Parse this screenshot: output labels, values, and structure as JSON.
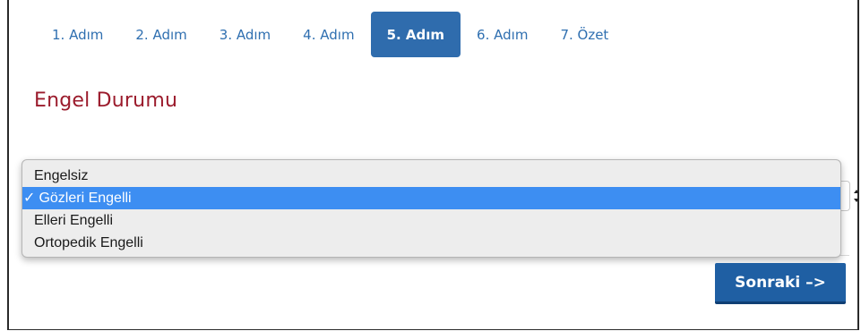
{
  "steps": [
    {
      "label": "1. Adım"
    },
    {
      "label": "2. Adım"
    },
    {
      "label": "3. Adım"
    },
    {
      "label": "4. Adım"
    },
    {
      "label": "5. Adım",
      "active": true
    },
    {
      "label": "6. Adım"
    },
    {
      "label": "7. Özet"
    }
  ],
  "section": {
    "title": "Engel Durumu"
  },
  "disability_select": {
    "selected_value": "Gözleri Engelli",
    "check_mark": "✓",
    "options": [
      {
        "label": "Engelsiz"
      },
      {
        "label": "Gözleri Engelli",
        "selected": true
      },
      {
        "label": "Elleri Engelli"
      },
      {
        "label": "Ortopedik Engelli"
      }
    ]
  },
  "next_button": {
    "label": "Sonraki –>"
  },
  "colors": {
    "active_step_bg": "#2f6cad",
    "step_text": "#2f6fb0",
    "title": "#9b1b2c",
    "selection_highlight": "#3d8ef2",
    "button_bg": "#1f5fa3"
  }
}
